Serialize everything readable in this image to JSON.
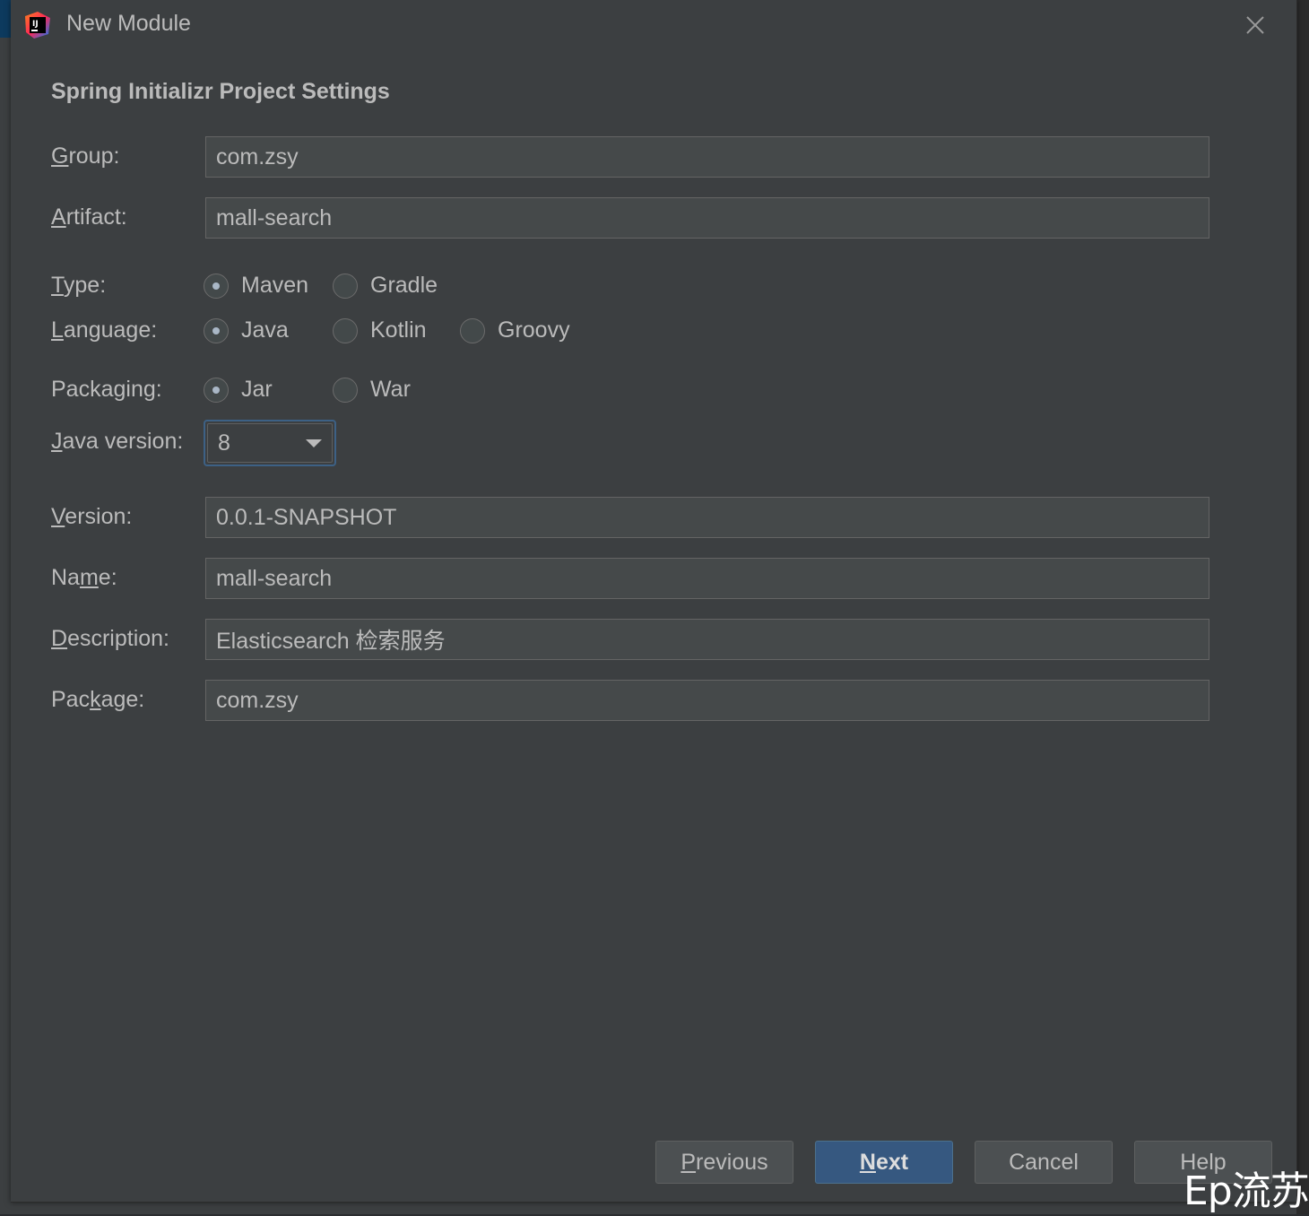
{
  "window": {
    "title": "New Module"
  },
  "section_title": "Spring Initializr Project Settings",
  "fields": {
    "group": {
      "label_ul": "G",
      "label_rest": "roup:",
      "value": "com.zsy"
    },
    "artifact": {
      "label_ul": "A",
      "label_rest": "rtifact:",
      "value": "mall-search"
    },
    "version": {
      "label_ul": "V",
      "label_rest": "ersion:",
      "value": "0.0.1-SNAPSHOT"
    },
    "name": {
      "label_pre": "Na",
      "label_ul": "m",
      "label_rest": "e:",
      "value": "mall-search"
    },
    "description": {
      "label_ul": "D",
      "label_rest": "escription:",
      "value": "Elasticsearch 检索服务"
    },
    "package": {
      "label_pre": "Pac",
      "label_ul": "k",
      "label_rest": "age:",
      "value": "com.zsy"
    }
  },
  "type": {
    "label_ul": "T",
    "label_rest": "ype:",
    "options": [
      "Maven",
      "Gradle"
    ],
    "selected": "Maven"
  },
  "language": {
    "label_ul": "L",
    "label_rest": "anguage:",
    "options": [
      "Java",
      "Kotlin",
      "Groovy"
    ],
    "selected": "Java"
  },
  "packaging": {
    "label_pre": "Packa",
    "label_ul": "g",
    "label_rest": "ing:",
    "options": [
      "Jar",
      "War"
    ],
    "selected": "Jar"
  },
  "java_version": {
    "label_ul": "J",
    "label_rest": "ava version:",
    "value": "8"
  },
  "buttons": {
    "previous_ul": "P",
    "previous_rest": "revious",
    "next_ul": "N",
    "next_rest": "ext",
    "cancel": "Cancel",
    "help": "Help"
  },
  "watermark": "Ep流苏",
  "colors": {
    "background": "#3c3f41",
    "text": "#bbbbbb",
    "input_bg": "#45494a",
    "primary_button": "#365880",
    "focus_border": "#3d6185"
  },
  "icons": {
    "app": "intellij-idea-icon",
    "close": "close-icon",
    "dropdown": "chevron-down-icon"
  }
}
